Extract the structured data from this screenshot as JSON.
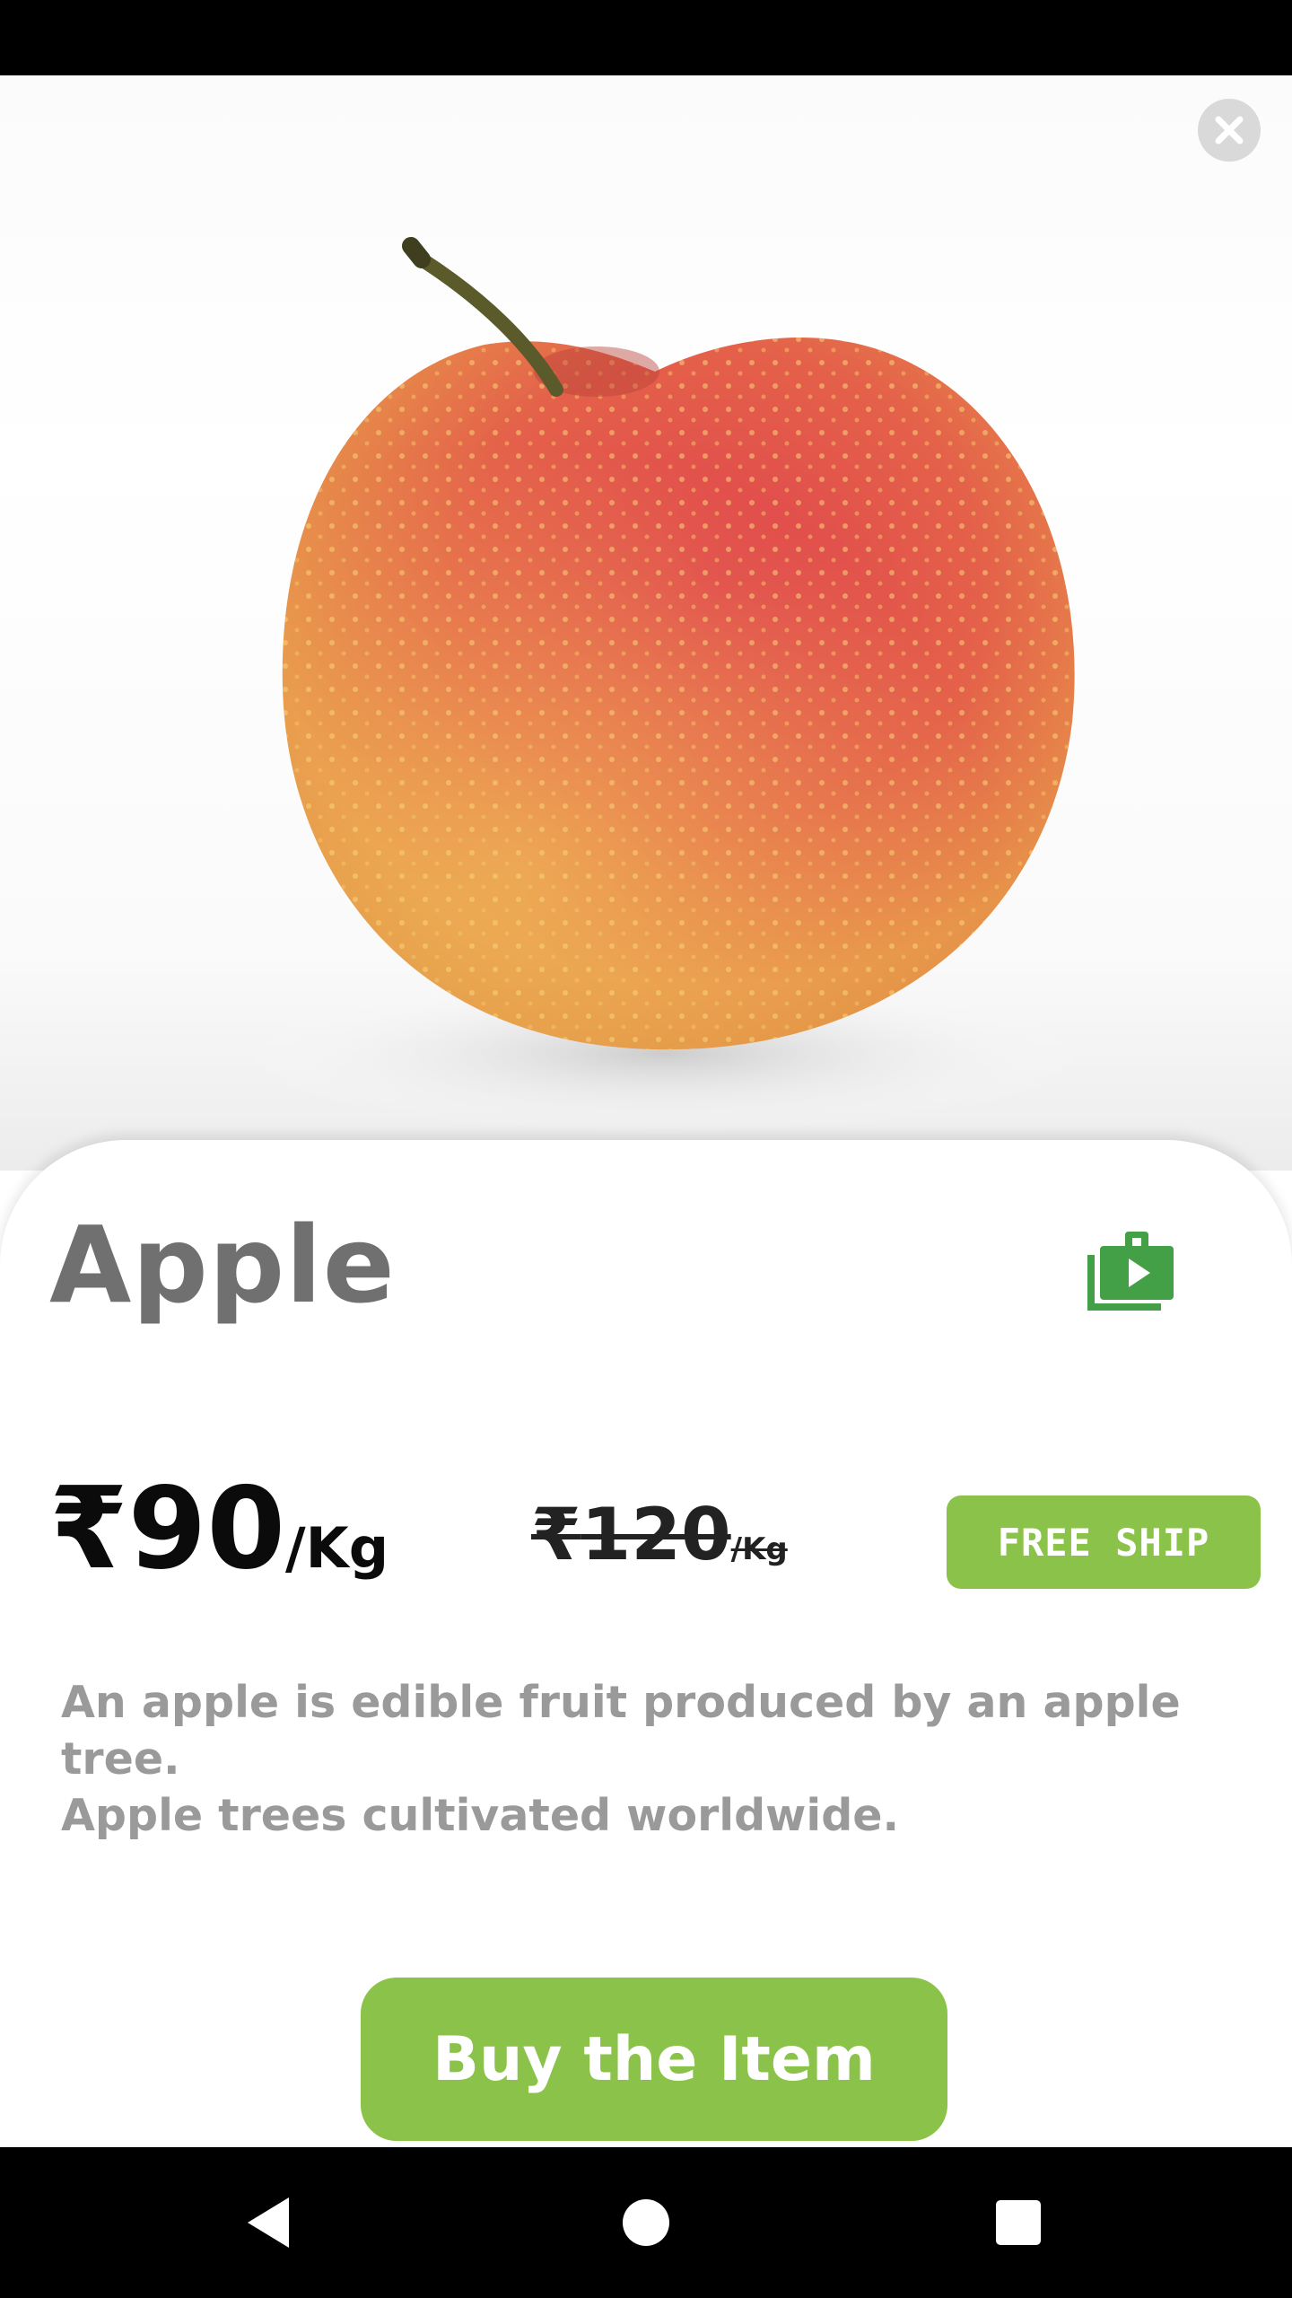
{
  "product": {
    "name": "Apple",
    "price": {
      "currency": "₹",
      "amount": "90",
      "unit": "/Kg"
    },
    "original_price": {
      "currency": "₹",
      "amount": "120",
      "unit": "/Kg"
    },
    "badge": "FREE SHIP",
    "description_lines": [
      "An apple is edible fruit produced by an apple tree.",
      "Apple trees cultivated worldwide."
    ]
  },
  "actions": {
    "buy_label": "Buy the Item"
  },
  "icons": {
    "close": "close-icon",
    "bag": "shopping-bag-play-icon",
    "nav_back": "back-icon",
    "nav_home": "home-icon",
    "nav_recents": "recents-icon"
  },
  "colors": {
    "accent": "#8bc34a",
    "icon_green": "#43a047",
    "title": "#707070",
    "description": "#9a9a9a"
  }
}
